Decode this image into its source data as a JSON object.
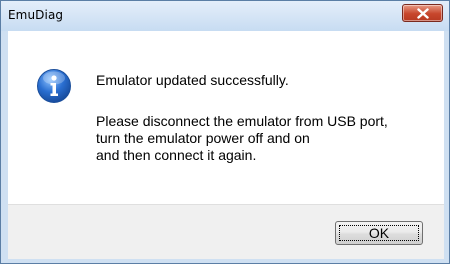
{
  "window": {
    "title": "EmuDiag",
    "close_icon": "close-x-icon",
    "close_color": "#c7462c"
  },
  "dialog": {
    "icon": "info-icon",
    "icon_color": "#2a6fd1",
    "message_main": "Emulator updated successfully.",
    "message_lines": [
      "Please disconnect the emulator from USB port,",
      "turn the emulator power off and on",
      "and then connect it again."
    ]
  },
  "buttons": {
    "ok_label": "OK"
  }
}
